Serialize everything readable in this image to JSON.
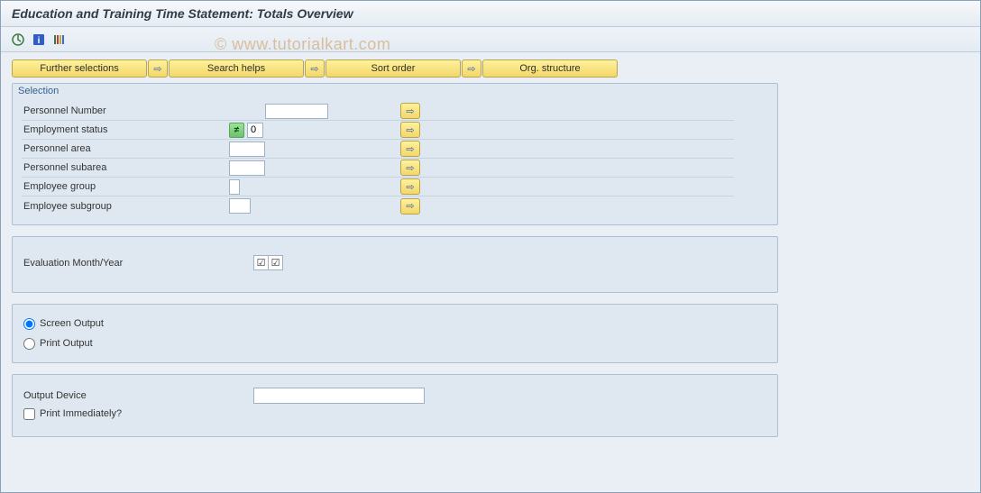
{
  "title": "Education and Training Time Statement: Totals Overview",
  "watermark": "© www.tutorialkart.com",
  "topButtons": {
    "further": "Further selections",
    "search": "Search helps",
    "sort": "Sort order",
    "org": "Org. structure"
  },
  "selection": {
    "legend": "Selection",
    "rows": {
      "persno": {
        "label": "Personnel Number",
        "value": ""
      },
      "status": {
        "label": "Employment status",
        "value": "0",
        "indicator": "≠"
      },
      "area": {
        "label": "Personnel area",
        "value": ""
      },
      "subarea": {
        "label": "Personnel subarea",
        "value": ""
      },
      "group": {
        "label": "Employee group",
        "value": ""
      },
      "subgroup": {
        "label": "Employee subgroup",
        "value": ""
      }
    }
  },
  "evaluation": {
    "label": "Evaluation Month/Year"
  },
  "output": {
    "screen": "Screen Output",
    "print": "Print Output"
  },
  "device": {
    "label": "Output Device",
    "value": "",
    "immediate": "Print Immediately?"
  }
}
